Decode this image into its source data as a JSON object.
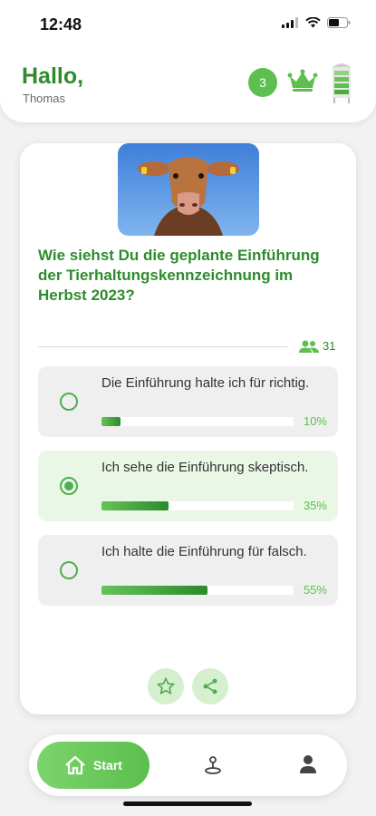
{
  "status_bar": {
    "time": "12:48"
  },
  "header": {
    "greeting": "Hallo,",
    "user_name": "Thomas",
    "level": "3"
  },
  "poll": {
    "question": "Wie siehst Du die geplante Einführung der Tierhaltungskennzeichnung im Herbst 2023?",
    "participants": "31",
    "options": [
      {
        "label": "Die Einführung halte ich für richtig.",
        "percent_label": "10%",
        "percent": 10,
        "selected": false
      },
      {
        "label": "Ich sehe die Einführung skeptisch.",
        "percent_label": "35%",
        "percent": 35,
        "selected": true
      },
      {
        "label": "Ich halte die Einführung für falsch.",
        "percent_label": "55%",
        "percent": 55,
        "selected": false
      }
    ]
  },
  "nav": {
    "start_label": "Start",
    "items": [
      "home-icon",
      "map-pin-icon",
      "profile-icon"
    ]
  },
  "colors": {
    "accent": "#2e8b2e",
    "accent_light": "#5cbf4e",
    "selected_bg": "#eaf6e6"
  }
}
